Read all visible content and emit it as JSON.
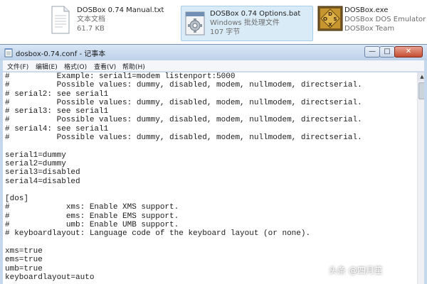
{
  "files": [
    {
      "name": "DOSBox 0.74 Manual.txt",
      "type": "文本文档",
      "size": "61.7 KB",
      "icon": "text-document-icon"
    },
    {
      "name": "DOSBox 0.74 Options.bat",
      "type": "Windows 批处理文件",
      "size": "107 字节",
      "icon": "batch-file-icon",
      "selected": true
    },
    {
      "name": "DOSBox.exe",
      "type": "DOSBox DOS Emulator",
      "size": "DOSBox Team",
      "icon": "dosbox-app-icon"
    }
  ],
  "window": {
    "title": "dosbox-0.74.conf - 记事本",
    "controls": {
      "minimize": "—",
      "maximize": "□",
      "close": "✕"
    }
  },
  "menu": [
    "文件(F)",
    "编辑(E)",
    "格式(O)",
    "查看(V)",
    "帮助(H)"
  ],
  "editor": {
    "lines": [
      "#          Example: serial1=modem listenport:5000",
      "#          Possible values: dummy, disabled, modem, nullmodem, directserial.",
      "# serial2: see serial1",
      "#          Possible values: dummy, disabled, modem, nullmodem, directserial.",
      "# serial3: see serial1",
      "#          Possible values: dummy, disabled, modem, nullmodem, directserial.",
      "# serial4: see serial1",
      "#          Possible values: dummy, disabled, modem, nullmodem, directserial.",
      "",
      "serial1=dummy",
      "serial2=dummy",
      "serial3=disabled",
      "serial4=disabled",
      "",
      "[dos]",
      "#            xms: Enable XMS support.",
      "#            ems: Enable EMS support.",
      "#            umb: Enable UMB support.",
      "# keyboardlayout: Language code of the keyboard layout (or none).",
      "",
      "xms=true",
      "ems=true",
      "umb=true",
      "keyboardlayout=auto"
    ]
  },
  "watermark": "头条 @四月笙",
  "colors": {
    "titlebar": "#c4d7ec",
    "selected_item": "#d9ebf7",
    "close_button": "#c44c31"
  }
}
